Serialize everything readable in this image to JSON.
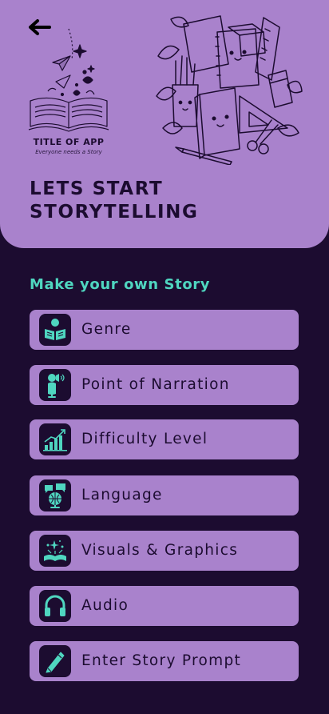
{
  "header": {
    "back_icon": "arrow-left-icon",
    "logo_title": "TITLE OF APP",
    "logo_tagline": "Everyone needs a Story",
    "title_line1": "LETS START",
    "title_line2": "STORYTELLING"
  },
  "section": {
    "heading": "Make your own Story"
  },
  "options": [
    {
      "label": "Genre",
      "icon": "book-reader-icon"
    },
    {
      "label": "Point of Narration",
      "icon": "microphone-person-icon"
    },
    {
      "label": "Difficulty Level",
      "icon": "growth-chart-icon"
    },
    {
      "label": "Language",
      "icon": "globe-speech-icon"
    },
    {
      "label": "Visuals & Graphics",
      "icon": "open-book-sparkle-icon"
    },
    {
      "label": "Audio",
      "icon": "headphones-icon"
    },
    {
      "label": "Enter Story Prompt",
      "icon": "pencil-icon"
    }
  ],
  "colors": {
    "background": "#1c0c30",
    "panel": "#a982cc",
    "accent": "#4fd6c0"
  }
}
